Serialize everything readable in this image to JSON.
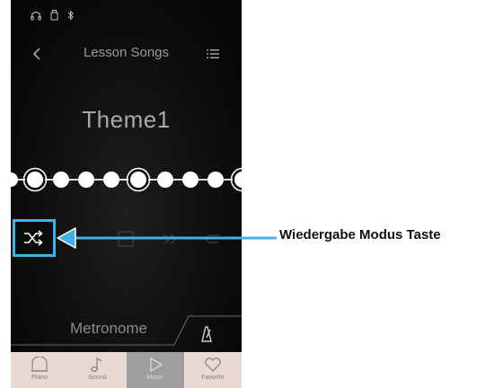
{
  "header": {
    "title": "Lesson Songs"
  },
  "song": {
    "title": "Theme1"
  },
  "metronome": {
    "label": "Metronome"
  },
  "bottom_nav": [
    {
      "label": "Piano",
      "icon": "piano-icon",
      "active": false
    },
    {
      "label": "Sound",
      "icon": "music-note-icon",
      "active": false
    },
    {
      "label": "Music",
      "icon": "play-icon",
      "active": true
    },
    {
      "label": "Favorite",
      "icon": "heart-icon",
      "active": false
    }
  ],
  "callout": {
    "text": "Wiedergabe Modus Taste"
  },
  "colors": {
    "highlight": "#3fb0e8",
    "screen_bg": "#0d0d0d",
    "nav_bg": "#e8d9d3"
  }
}
